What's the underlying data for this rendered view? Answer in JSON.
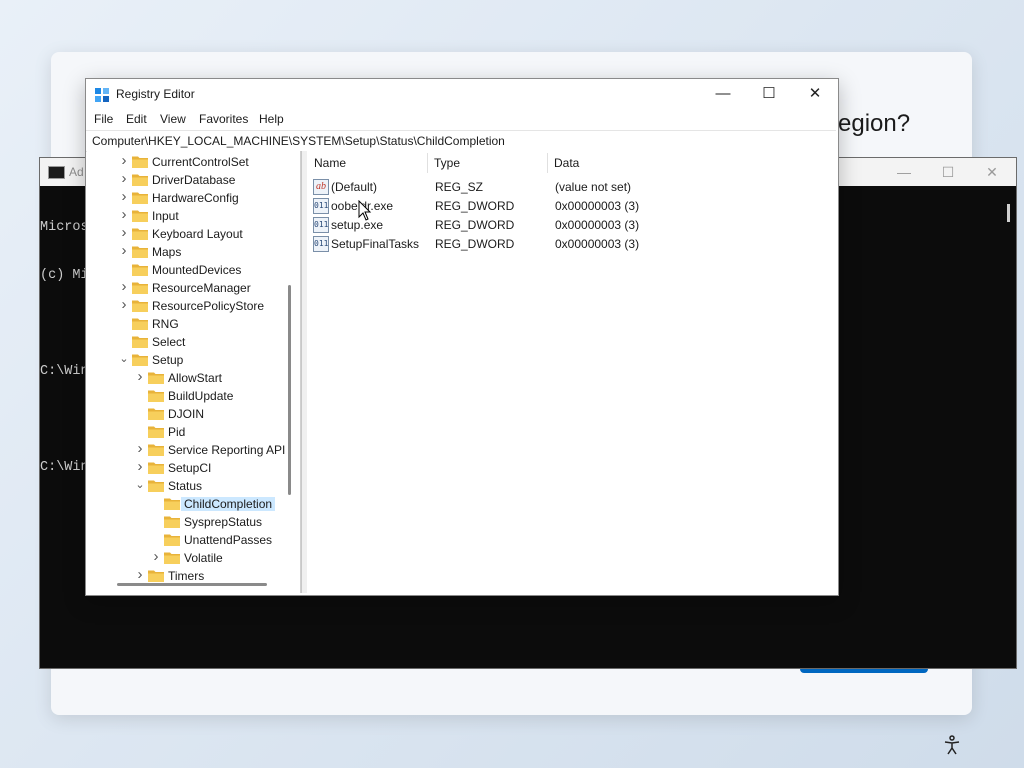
{
  "oobe": {
    "heading": "region?"
  },
  "cmd": {
    "title": "Ad",
    "lines": [
      "Micros",
      "(c) Mi",
      "",
      "C:\\Win",
      "",
      "C:\\Win"
    ],
    "controls": {
      "minimize": "—",
      "maximize": "☐",
      "close": "✕"
    }
  },
  "regedit": {
    "title": "Registry Editor",
    "controls": {
      "minimize": "—",
      "maximize": "☐",
      "close": "✕"
    },
    "menu": [
      "File",
      "Edit",
      "View",
      "Favorites",
      "Help"
    ],
    "address": "Computer\\HKEY_LOCAL_MACHINE\\SYSTEM\\Setup\\Status\\ChildCompletion",
    "tree": [
      {
        "label": "CurrentControlSet",
        "expander": ">"
      },
      {
        "label": "DriverDatabase",
        "expander": ">"
      },
      {
        "label": "HardwareConfig",
        "expander": ">"
      },
      {
        "label": "Input",
        "expander": ">"
      },
      {
        "label": "Keyboard Layout",
        "expander": ">"
      },
      {
        "label": "Maps",
        "expander": ">"
      },
      {
        "label": "MountedDevices",
        "expander": ""
      },
      {
        "label": "ResourceManager",
        "expander": ">"
      },
      {
        "label": "ResourcePolicyStore",
        "expander": ">"
      },
      {
        "label": "RNG",
        "expander": ""
      },
      {
        "label": "Select",
        "expander": ""
      },
      {
        "label": "Setup",
        "expander": "v"
      },
      {
        "label": "AllowStart",
        "expander": ">"
      },
      {
        "label": "BuildUpdate",
        "expander": ""
      },
      {
        "label": "DJOIN",
        "expander": ""
      },
      {
        "label": "Pid",
        "expander": ""
      },
      {
        "label": "Service Reporting API",
        "expander": ">"
      },
      {
        "label": "SetupCI",
        "expander": ">"
      },
      {
        "label": "Status",
        "expander": "v"
      },
      {
        "label": "ChildCompletion",
        "expander": ""
      },
      {
        "label": "SysprepStatus",
        "expander": ""
      },
      {
        "label": "UnattendPasses",
        "expander": ""
      },
      {
        "label": "Volatile",
        "expander": ">"
      },
      {
        "label": "Timers",
        "expander": ">"
      }
    ],
    "columns": {
      "name": "Name",
      "type": "Type",
      "data": "Data"
    },
    "values": [
      {
        "name": "(Default)",
        "type": "REG_SZ",
        "data": "(value not set)",
        "icon": "string-value-icon"
      },
      {
        "name": "oobeldr.exe",
        "type": "REG_DWORD",
        "data": "0x00000003 (3)",
        "icon": "binary-value-icon"
      },
      {
        "name": "setup.exe",
        "type": "REG_DWORD",
        "data": "0x00000003 (3)",
        "icon": "binary-value-icon"
      },
      {
        "name": "SetupFinalTasks",
        "type": "REG_DWORD",
        "data": "0x00000003 (3)",
        "icon": "binary-value-icon"
      }
    ],
    "icon_labels": {
      "string": "ab",
      "binary": "011"
    }
  }
}
